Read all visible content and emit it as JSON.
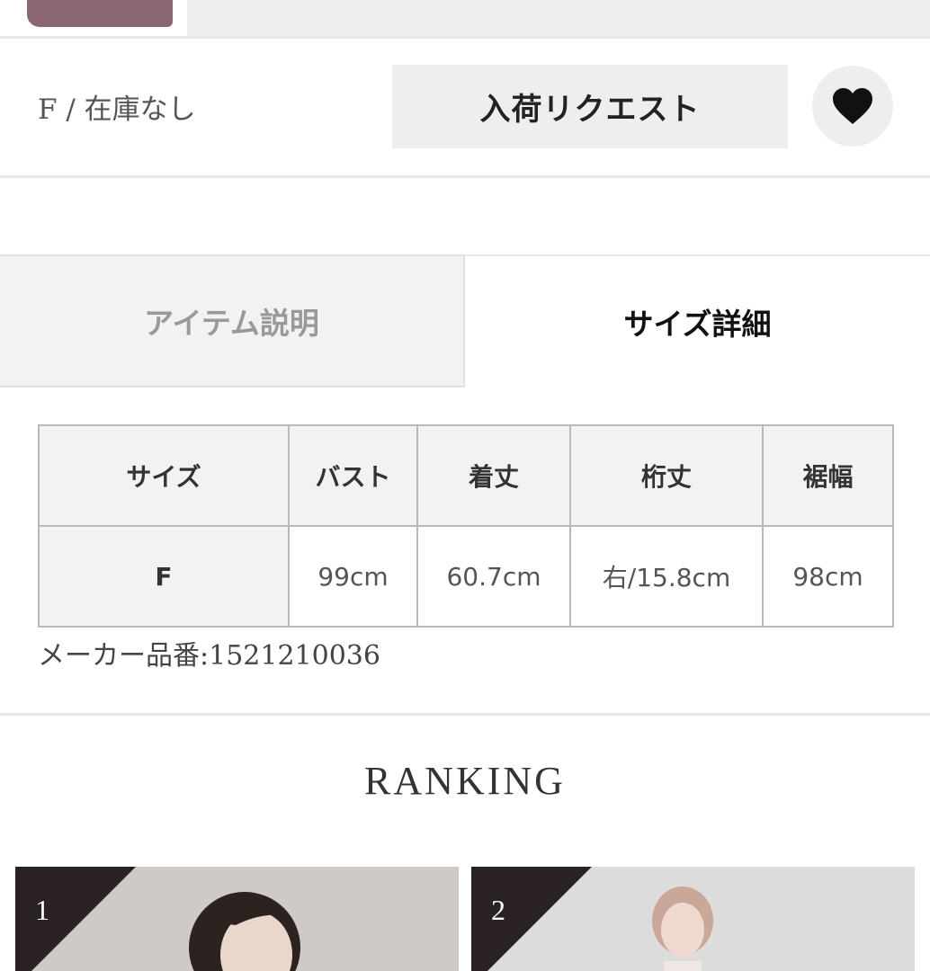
{
  "stock": {
    "label": "F / 在庫なし"
  },
  "actions": {
    "request_label": "入荷リクエスト"
  },
  "icons": {
    "favorite": "heart-icon"
  },
  "tabs": [
    {
      "label": "アイテム説明",
      "active": false
    },
    {
      "label": "サイズ詳細",
      "active": true
    }
  ],
  "size_table": {
    "headers": [
      "サイズ",
      "バスト",
      "着丈",
      "桁丈",
      "裾幅"
    ],
    "rows": [
      [
        "F",
        "99cm",
        "60.7cm",
        "右/15.8cm",
        "98cm"
      ]
    ]
  },
  "maker_number": "メーカー品番:1521210036",
  "ranking": {
    "title": "RANKING",
    "items": [
      {
        "rank": "1"
      },
      {
        "rank": "2"
      }
    ]
  },
  "colors": {
    "product_swatch": "#8a6673",
    "rank_badge": "#2a2222",
    "tab_inactive_bg": "#f2f2f2"
  }
}
